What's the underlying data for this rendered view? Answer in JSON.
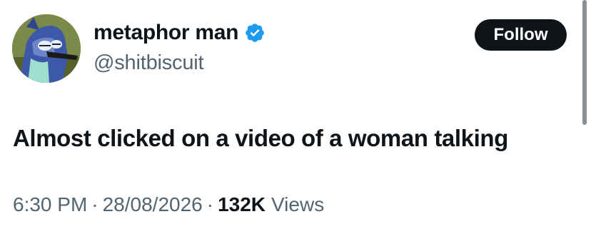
{
  "tweet": {
    "author": {
      "display_name": "metaphor man",
      "handle": "@shitbiscuit",
      "verified": true
    },
    "follow_label": "Follow",
    "text": "Almost clicked on a video of a woman talking",
    "meta": {
      "time": "6:30 PM",
      "date": "28/08/2026",
      "separator": "·",
      "views_count": "132K",
      "views_label": "Views"
    }
  },
  "colors": {
    "text_primary": "#0f1419",
    "text_secondary": "#536471",
    "verified_badge": "#1d9bf0",
    "follow_button_bg": "#0f1419",
    "follow_button_text": "#ffffff"
  },
  "icons": {
    "verified": "verified-badge-icon",
    "avatar": "cartoon-bird-avatar"
  }
}
